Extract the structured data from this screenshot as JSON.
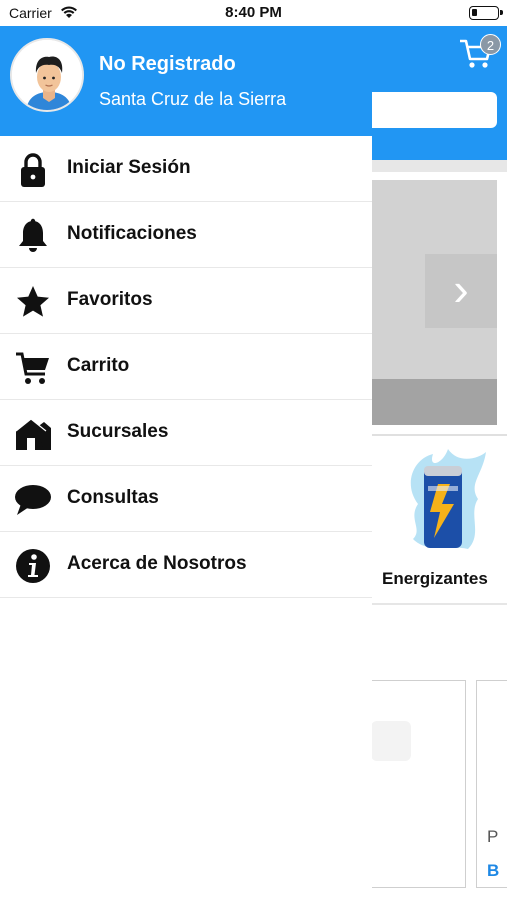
{
  "status_bar": {
    "carrier": "Carrier",
    "time": "8:40 PM",
    "battery_level": 0.2
  },
  "background": {
    "cart_badge": "2",
    "carousel_next_glyph": "›",
    "category_label": "Energizantes",
    "card_letter_p": "P",
    "card_letter_b": "B"
  },
  "drawer": {
    "user_name": "No Registrado",
    "user_city": "Santa Cruz de la Sierra",
    "items": [
      {
        "label": "Iniciar Sesión",
        "icon": "lock-icon"
      },
      {
        "label": "Notificaciones",
        "icon": "bell-icon"
      },
      {
        "label": "Favoritos",
        "icon": "star-icon"
      },
      {
        "label": "Carrito",
        "icon": "cart-icon"
      },
      {
        "label": "Sucursales",
        "icon": "store-icon"
      },
      {
        "label": "Consultas",
        "icon": "chat-bubble-icon"
      },
      {
        "label": "Acerca de Nosotros",
        "icon": "info-icon"
      }
    ]
  },
  "colors": {
    "primary": "#2196f3",
    "menu_text": "#111111",
    "divider": "#e8e8e8"
  }
}
